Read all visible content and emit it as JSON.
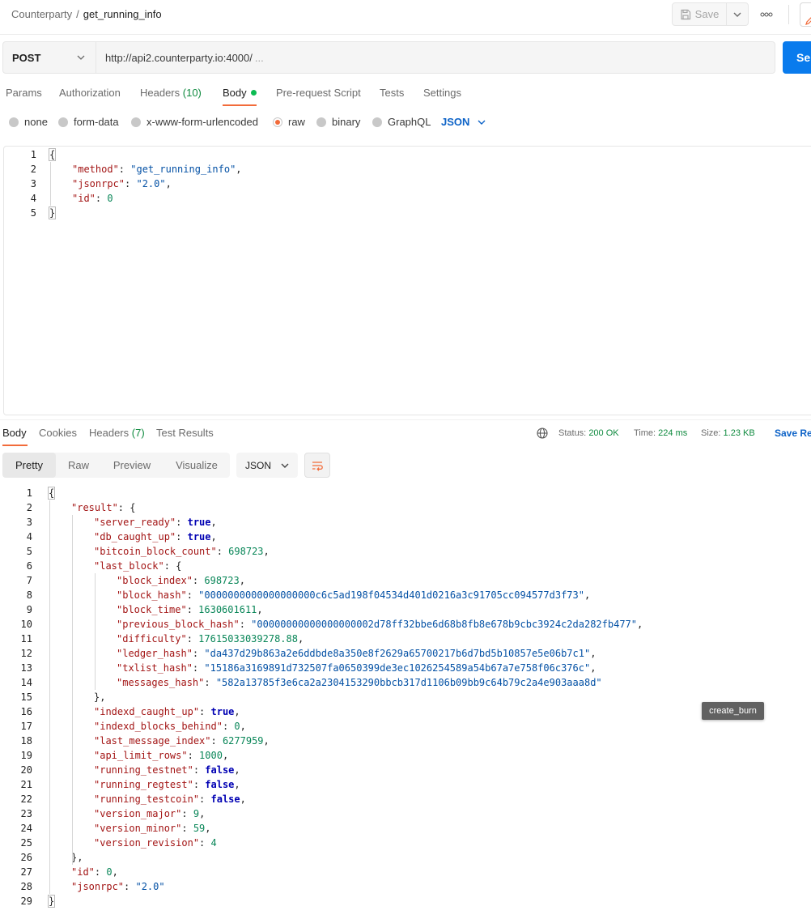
{
  "breadcrumb": {
    "parent": "Counterparty",
    "separator": "/",
    "current": "get_running_info"
  },
  "toolbar": {
    "save_label": "Save",
    "more_label": "ooo"
  },
  "request": {
    "method": "POST",
    "url": "http://api2.counterparty.io:4000/",
    "url_ellipsis": "...",
    "send_label": "Se"
  },
  "request_tabs": [
    {
      "label": "Params"
    },
    {
      "label": "Authorization"
    },
    {
      "label": "Headers",
      "count": "(10)"
    },
    {
      "label": "Body"
    },
    {
      "label": "Pre-request Script"
    },
    {
      "label": "Tests"
    },
    {
      "label": "Settings"
    }
  ],
  "body_types": [
    {
      "label": "none",
      "selected": false
    },
    {
      "label": "form-data",
      "selected": false
    },
    {
      "label": "x-www-form-urlencoded",
      "selected": false
    },
    {
      "label": "raw",
      "selected": true
    },
    {
      "label": "binary",
      "selected": false
    },
    {
      "label": "GraphQL",
      "selected": false
    }
  ],
  "body_language": "JSON",
  "request_body": {
    "line_numbers": [
      "1",
      "2",
      "3",
      "4",
      "5"
    ],
    "lines": [
      [
        [
          "p",
          "{"
        ]
      ],
      [
        [
          "k",
          "\"method\""
        ],
        [
          "p",
          ": "
        ],
        [
          "s",
          "\"get_running_info\""
        ],
        [
          "p",
          ","
        ]
      ],
      [
        [
          "k",
          "\"jsonrpc\""
        ],
        [
          "p",
          ": "
        ],
        [
          "s",
          "\"2.0\""
        ],
        [
          "p",
          ","
        ]
      ],
      [
        [
          "k",
          "\"id\""
        ],
        [
          "p",
          ": "
        ],
        [
          "n",
          "0"
        ]
      ],
      [
        [
          "p",
          "}"
        ]
      ]
    ]
  },
  "response_tabs": [
    {
      "label": "Body"
    },
    {
      "label": "Cookies"
    },
    {
      "label": "Headers",
      "count": "(7)"
    },
    {
      "label": "Test Results"
    }
  ],
  "response_meta": {
    "status_label": "Status:",
    "status_value": "200 OK",
    "time_label": "Time:",
    "time_value": "224 ms",
    "size_label": "Size:",
    "size_value": "1.23 KB",
    "save_label": "Save Re"
  },
  "view_modes": [
    "Pretty",
    "Raw",
    "Preview",
    "Visualize"
  ],
  "response_format": "JSON",
  "tooltip": "create_burn",
  "colors": {
    "accent": "#f26b3a",
    "primary": "#097bed",
    "success": "#0f8a3f",
    "link": "#0c62c7"
  },
  "response_body": {
    "line_numbers": [
      "1",
      "2",
      "3",
      "4",
      "5",
      "6",
      "7",
      "8",
      "9",
      "10",
      "11",
      "12",
      "13",
      "14",
      "15",
      "16",
      "17",
      "18",
      "19",
      "20",
      "21",
      "22",
      "23",
      "24",
      "25",
      "26",
      "27",
      "28",
      "29"
    ],
    "lines": [
      [
        [
          "p",
          "{"
        ]
      ],
      [
        [
          "k",
          "\"result\""
        ],
        [
          "p",
          ": {"
        ]
      ],
      [
        [
          "k",
          "\"server_ready\""
        ],
        [
          "p",
          ": "
        ],
        [
          "b",
          "true"
        ],
        [
          "p",
          ","
        ]
      ],
      [
        [
          "k",
          "\"db_caught_up\""
        ],
        [
          "p",
          ": "
        ],
        [
          "b",
          "true"
        ],
        [
          "p",
          ","
        ]
      ],
      [
        [
          "k",
          "\"bitcoin_block_count\""
        ],
        [
          "p",
          ": "
        ],
        [
          "n",
          "698723"
        ],
        [
          "p",
          ","
        ]
      ],
      [
        [
          "k",
          "\"last_block\""
        ],
        [
          "p",
          ": {"
        ]
      ],
      [
        [
          "k",
          "\"block_index\""
        ],
        [
          "p",
          ": "
        ],
        [
          "n",
          "698723"
        ],
        [
          "p",
          ","
        ]
      ],
      [
        [
          "k",
          "\"block_hash\""
        ],
        [
          "p",
          ": "
        ],
        [
          "s",
          "\"0000000000000000000c6c5ad198f04534d401d0216a3c91705cc094577d3f73\""
        ],
        [
          "p",
          ","
        ]
      ],
      [
        [
          "k",
          "\"block_time\""
        ],
        [
          "p",
          ": "
        ],
        [
          "n",
          "1630601611"
        ],
        [
          "p",
          ","
        ]
      ],
      [
        [
          "k",
          "\"previous_block_hash\""
        ],
        [
          "p",
          ": "
        ],
        [
          "s",
          "\"00000000000000000002d78ff32bbe6d68b8fb8e678b9cbc3924c2da282fb477\""
        ],
        [
          "p",
          ","
        ]
      ],
      [
        [
          "k",
          "\"difficulty\""
        ],
        [
          "p",
          ": "
        ],
        [
          "n",
          "17615033039278.88"
        ],
        [
          "p",
          ","
        ]
      ],
      [
        [
          "k",
          "\"ledger_hash\""
        ],
        [
          "p",
          ": "
        ],
        [
          "s",
          "\"da437d29b863a2e6ddbde8a350e8f2629a65700217b6d7bd5b10857e5e06b7c1\""
        ],
        [
          "p",
          ","
        ]
      ],
      [
        [
          "k",
          "\"txlist_hash\""
        ],
        [
          "p",
          ": "
        ],
        [
          "s",
          "\"15186a3169891d732507fa0650399de3ec1026254589a54b67a7e758f06c376c\""
        ],
        [
          "p",
          ","
        ]
      ],
      [
        [
          "k",
          "\"messages_hash\""
        ],
        [
          "p",
          ": "
        ],
        [
          "s",
          "\"582a13785f3e6ca2a2304153290bbcb317d1106b09bb9c64b79c2a4e903aaa8d\""
        ]
      ],
      [
        [
          "p",
          "},"
        ]
      ],
      [
        [
          "k",
          "\"indexd_caught_up\""
        ],
        [
          "p",
          ": "
        ],
        [
          "b",
          "true"
        ],
        [
          "p",
          ","
        ]
      ],
      [
        [
          "k",
          "\"indexd_blocks_behind\""
        ],
        [
          "p",
          ": "
        ],
        [
          "n",
          "0"
        ],
        [
          "p",
          ","
        ]
      ],
      [
        [
          "k",
          "\"last_message_index\""
        ],
        [
          "p",
          ": "
        ],
        [
          "n",
          "6277959"
        ],
        [
          "p",
          ","
        ]
      ],
      [
        [
          "k",
          "\"api_limit_rows\""
        ],
        [
          "p",
          ": "
        ],
        [
          "n",
          "1000"
        ],
        [
          "p",
          ","
        ]
      ],
      [
        [
          "k",
          "\"running_testnet\""
        ],
        [
          "p",
          ": "
        ],
        [
          "b",
          "false"
        ],
        [
          "p",
          ","
        ]
      ],
      [
        [
          "k",
          "\"running_regtest\""
        ],
        [
          "p",
          ": "
        ],
        [
          "b",
          "false"
        ],
        [
          "p",
          ","
        ]
      ],
      [
        [
          "k",
          "\"running_testcoin\""
        ],
        [
          "p",
          ": "
        ],
        [
          "b",
          "false"
        ],
        [
          "p",
          ","
        ]
      ],
      [
        [
          "k",
          "\"version_major\""
        ],
        [
          "p",
          ": "
        ],
        [
          "n",
          "9"
        ],
        [
          "p",
          ","
        ]
      ],
      [
        [
          "k",
          "\"version_minor\""
        ],
        [
          "p",
          ": "
        ],
        [
          "n",
          "59"
        ],
        [
          "p",
          ","
        ]
      ],
      [
        [
          "k",
          "\"version_revision\""
        ],
        [
          "p",
          ": "
        ],
        [
          "n",
          "4"
        ]
      ],
      [
        [
          "p",
          "},"
        ]
      ],
      [
        [
          "k",
          "\"id\""
        ],
        [
          "p",
          ": "
        ],
        [
          "n",
          "0"
        ],
        [
          "p",
          ","
        ]
      ],
      [
        [
          "k",
          "\"jsonrpc\""
        ],
        [
          "p",
          ": "
        ],
        [
          "s",
          "\"2.0\""
        ]
      ],
      [
        [
          "p",
          "}"
        ]
      ]
    ]
  }
}
